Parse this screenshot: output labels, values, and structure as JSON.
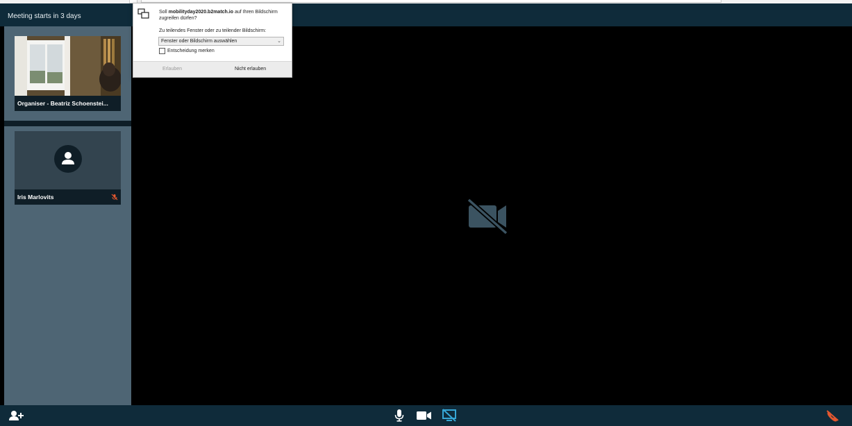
{
  "meeting": {
    "status": "Meeting starts in 3 days"
  },
  "participants": [
    {
      "name": "Organiser - Beatriz Schoenstei...",
      "video": "camera-feed",
      "muted": false
    },
    {
      "name": "Iris Marlovits",
      "video": "avatar-placeholder",
      "muted": true
    }
  ],
  "main_stage": {
    "icon": "camera-off-icon"
  },
  "controls": {
    "left": [
      {
        "icon": "add-participant-icon"
      }
    ],
    "center": [
      {
        "icon": "microphone-icon"
      },
      {
        "icon": "camera-icon"
      },
      {
        "icon": "screen-share-off-icon",
        "active": true
      }
    ],
    "right": [
      {
        "icon": "hang-up-icon"
      }
    ]
  },
  "share_dialog": {
    "question_prefix": "Soll ",
    "host": "mobilityday2020.b2match.io",
    "question_suffix": " auf Ihren Bildschirm zugreifen dürfen?",
    "select_label": "Zu teilendes Fenster oder zu teilender Bildschirm:",
    "select_value": "Fenster oder Bildschirm auswählen",
    "remember_label": "Entscheidung merken",
    "remember_checked": false,
    "allow_label": "Erlauben",
    "deny_label": "Nicht erlauben"
  },
  "colors": {
    "topbar": "#0f2b3a",
    "sidebar": "#4e6574",
    "accent_blue": "#36a7d6",
    "danger": "#e2572f",
    "icon_muted": "#3b5361"
  }
}
